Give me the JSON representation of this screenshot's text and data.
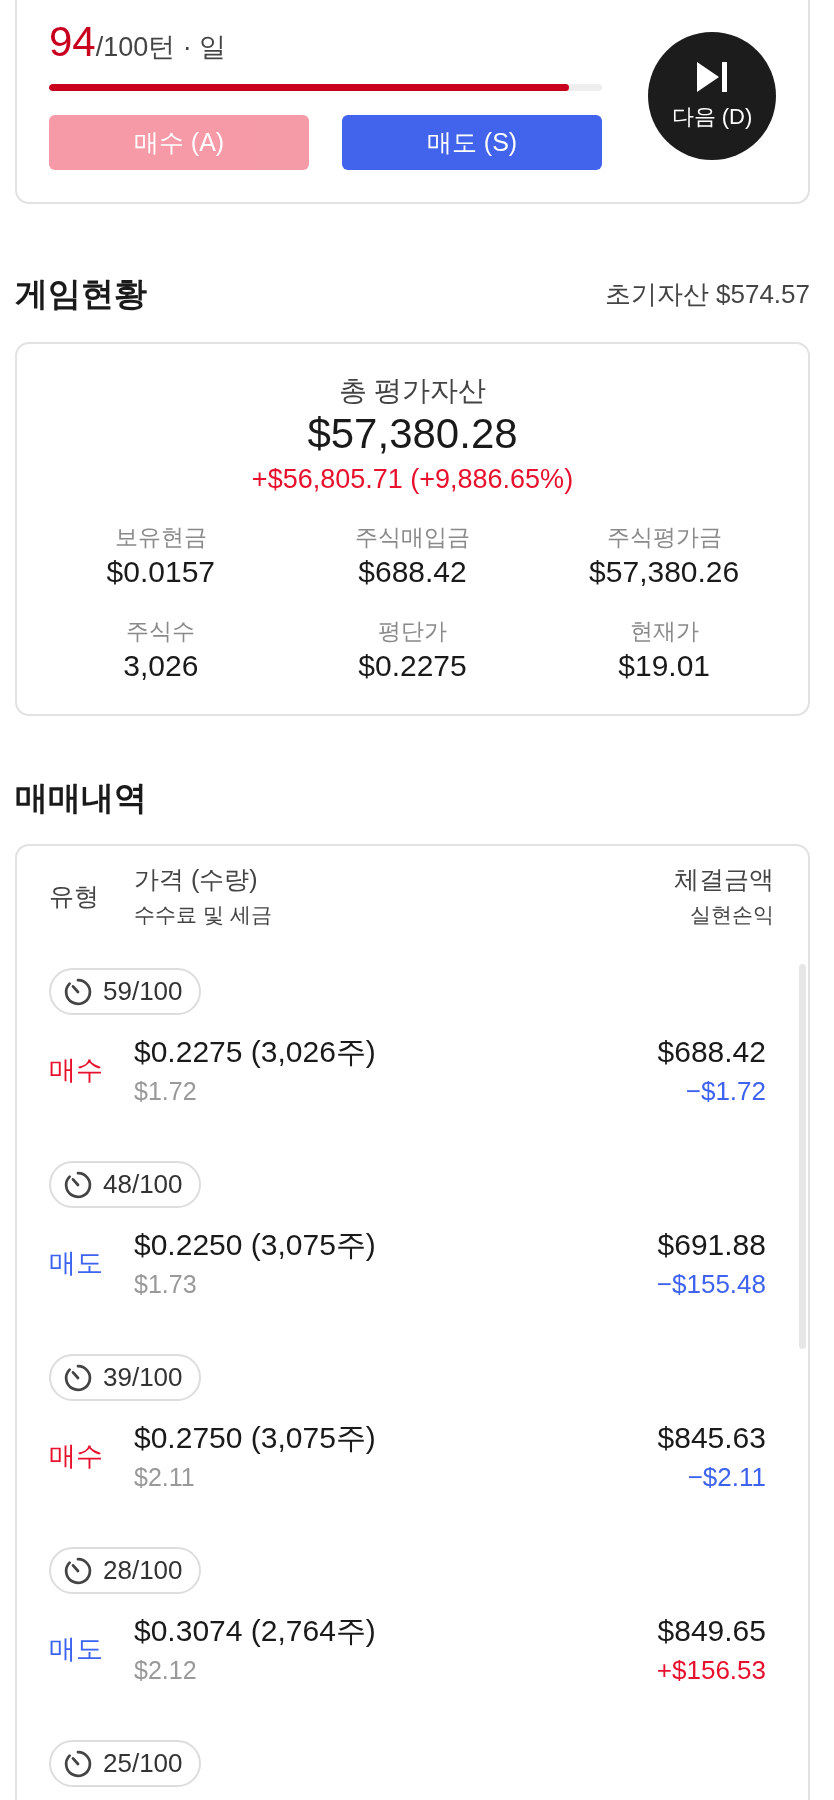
{
  "progress": {
    "turn": "94",
    "total": "/100턴 · 일",
    "level": 0.94
  },
  "actions": [
    {
      "kind": "buy",
      "label": "매수 (A)",
      "disabled": true
    },
    {
      "kind": "sell",
      "label": "매도 (S)",
      "disabled": false
    }
  ],
  "next_button": {
    "label": "다음 (D)"
  },
  "game_status": {
    "title": "게임현황",
    "initial_assets": "초기자산 $574.57",
    "total_label": "총 평가자산",
    "total_value": "$57,380.28",
    "change": "+$56,805.71 (+9,886.65%)",
    "change_gain": true,
    "stats": [
      {
        "label": "보유현금",
        "value": "$0.0157"
      },
      {
        "label": "주식매입금",
        "value": "$688.42"
      },
      {
        "label": "주식평가금",
        "value": "$57,380.26"
      },
      {
        "label": "주식수",
        "value": "3,026"
      },
      {
        "label": "평단가",
        "value": "$0.2275"
      },
      {
        "label": "현재가",
        "value": "$19.01"
      }
    ]
  },
  "trades": {
    "title": "매매내역",
    "columns": [
      {
        "main": "유형"
      },
      {
        "main": "가격 (수량)",
        "sub": "수수료 및 세금"
      },
      {
        "main": "체결금액",
        "sub": "실현손익"
      }
    ],
    "rows": [
      {
        "turn": "59/100",
        "kind": "buy",
        "type": "매수",
        "price": "$0.2275 (3,026주)",
        "fee": "$1.72",
        "amount": "$688.42",
        "pnl": "−$1.72",
        "gain": false
      },
      {
        "turn": "48/100",
        "kind": "sell",
        "type": "매도",
        "price": "$0.2250 (3,075주)",
        "fee": "$1.73",
        "amount": "$691.88",
        "pnl": "−$155.48",
        "gain": false
      },
      {
        "turn": "39/100",
        "kind": "buy",
        "type": "매수",
        "price": "$0.2750 (3,075주)",
        "fee": "$2.11",
        "amount": "$845.63",
        "pnl": "−$2.11",
        "gain": false
      },
      {
        "turn": "28/100",
        "kind": "sell",
        "type": "매도",
        "price": "$0.3074 (2,764주)",
        "fee": "$2.12",
        "amount": "$849.65",
        "pnl": "+$156.53",
        "gain": true
      },
      {
        "turn": "25/100"
      }
    ]
  }
}
